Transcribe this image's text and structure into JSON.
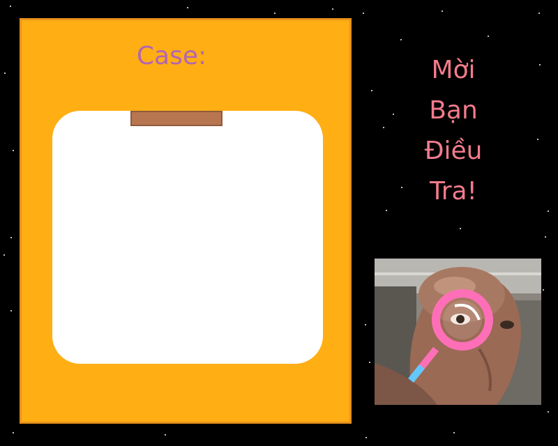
{
  "case_panel": {
    "title": "Case:"
  },
  "invite_text": {
    "line1": "Mời",
    "line2": "Bạn",
    "line3": "Điều",
    "line4": "Tra!"
  },
  "colors": {
    "background": "#000000",
    "panel": "#FFAE14",
    "panel_title": "#B265B3",
    "clip": "#B87650",
    "invite_text": "#F27C8C",
    "magnifier": "#FF6FB8",
    "magnifier_handle": "#63C8FF"
  },
  "photo": {
    "subject": "bald-man-with-magnifying-glass",
    "icon": "magnifying-glass-icon"
  }
}
